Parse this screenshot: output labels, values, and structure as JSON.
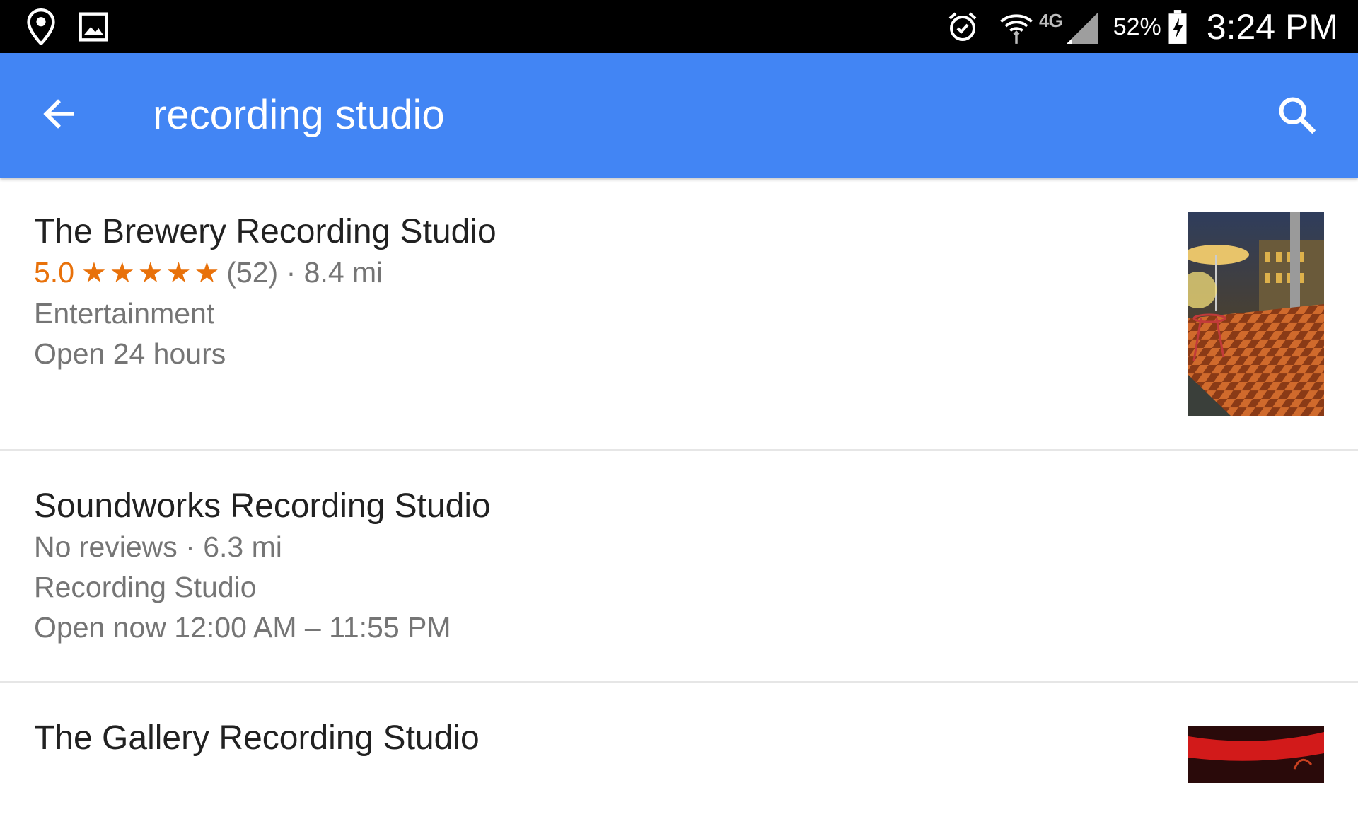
{
  "status_bar": {
    "left_icons": [
      "location-pin-icon",
      "image-icon"
    ],
    "right_icons": [
      "alarm-icon",
      "wifi-icon",
      "signal-icon",
      "battery-charging-icon"
    ],
    "network": "4G",
    "battery": "52%",
    "time": "3:24 PM"
  },
  "app_bar": {
    "back_icon": "arrow-back-icon",
    "query": "recording studio",
    "search_icon": "search-icon",
    "color": "#4285f4"
  },
  "results": [
    {
      "name": "The Brewery Recording Studio",
      "rating": "5.0",
      "stars": "★★★★★",
      "reviews": "(52)",
      "distance": "· 8.4 mi",
      "category": "Entertainment",
      "hours": "Open 24 hours",
      "has_photo": true
    },
    {
      "name": "Soundworks Recording Studio",
      "reviews_distance": "No reviews · 6.3 mi",
      "category": "Recording Studio",
      "hours": "Open now 12:00 AM – 11:55 PM",
      "has_photo": false
    },
    {
      "name": "The Gallery Recording Studio",
      "has_photo": true
    }
  ],
  "colors": {
    "rating_orange": "#e8710a",
    "secondary_text": "#757575",
    "primary_text": "#212121"
  }
}
